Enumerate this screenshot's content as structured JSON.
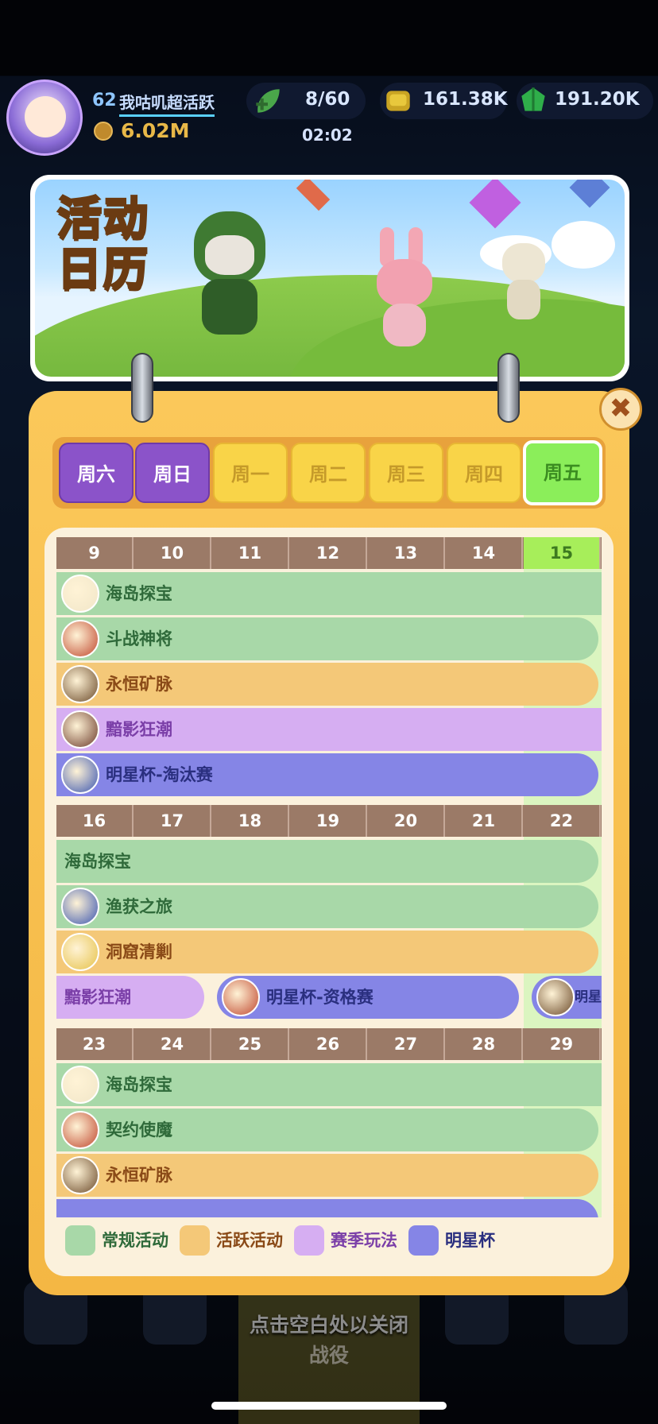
{
  "header": {
    "level": "62",
    "player_name": "我咕叽超活跃",
    "power": "6.02M",
    "stamina": "8/60",
    "stamina_timer": "02:02",
    "gold": "161.38K",
    "gems": "191.20K"
  },
  "banner": {
    "title_line1": "活动",
    "title_line2": "日历"
  },
  "close_label": "✖",
  "tabs": [
    {
      "label": "周六",
      "kind": "weekend"
    },
    {
      "label": "周日",
      "kind": "weekend"
    },
    {
      "label": "周一",
      "kind": "week"
    },
    {
      "label": "周二",
      "kind": "week"
    },
    {
      "label": "周三",
      "kind": "week"
    },
    {
      "label": "周四",
      "kind": "week"
    },
    {
      "label": "周五",
      "kind": "today"
    }
  ],
  "weeks": [
    {
      "dates": [
        "9",
        "10",
        "11",
        "12",
        "13",
        "14",
        "15"
      ],
      "events": [
        {
          "name": "海岛探宝",
          "color": "g",
          "icon": true
        },
        {
          "name": "斗战神将",
          "color": "g",
          "icon": true
        },
        {
          "name": "永恒矿脉",
          "color": "o",
          "icon": true
        },
        {
          "name": "黯影狂潮",
          "color": "p",
          "icon": true
        },
        {
          "name": "明星杯-淘汰赛",
          "color": "b",
          "icon": true
        }
      ]
    },
    {
      "dates": [
        "16",
        "17",
        "18",
        "19",
        "20",
        "21",
        "22"
      ],
      "events": [
        {
          "name": "海岛探宝",
          "color": "g",
          "icon": false
        },
        {
          "name": "渔获之旅",
          "color": "g",
          "icon": true
        },
        {
          "name": "洞窟清剿",
          "color": "o",
          "icon": true
        },
        {
          "name": "黯影狂潮",
          "color": "p",
          "icon": false
        },
        {
          "name": "明星杯-资格赛",
          "color": "b",
          "icon": true
        },
        {
          "name": "明星",
          "color": "b",
          "icon": true
        }
      ]
    },
    {
      "dates": [
        "23",
        "24",
        "25",
        "26",
        "27",
        "28",
        "29"
      ],
      "events": [
        {
          "name": "海岛探宝",
          "color": "g",
          "icon": true
        },
        {
          "name": "契约使魔",
          "color": "g",
          "icon": true
        },
        {
          "name": "永恒矿脉",
          "color": "o",
          "icon": true
        },
        {
          "name": "",
          "color": "b",
          "icon": false
        }
      ]
    }
  ],
  "legend": [
    {
      "label": "常规活动",
      "color": "#a8d8a8",
      "text_color": "#2f6a3a"
    },
    {
      "label": "活跃活动",
      "color": "#f4c878",
      "text_color": "#8a4a17"
    },
    {
      "label": "赛季玩法",
      "color": "#d6aef2",
      "text_color": "#7b3fa8"
    },
    {
      "label": "明星杯",
      "color": "#8585e6",
      "text_color": "#2a2f7f"
    }
  ],
  "hint": {
    "close_hint": "点击空白处以关闭",
    "behind_label": "战役"
  }
}
